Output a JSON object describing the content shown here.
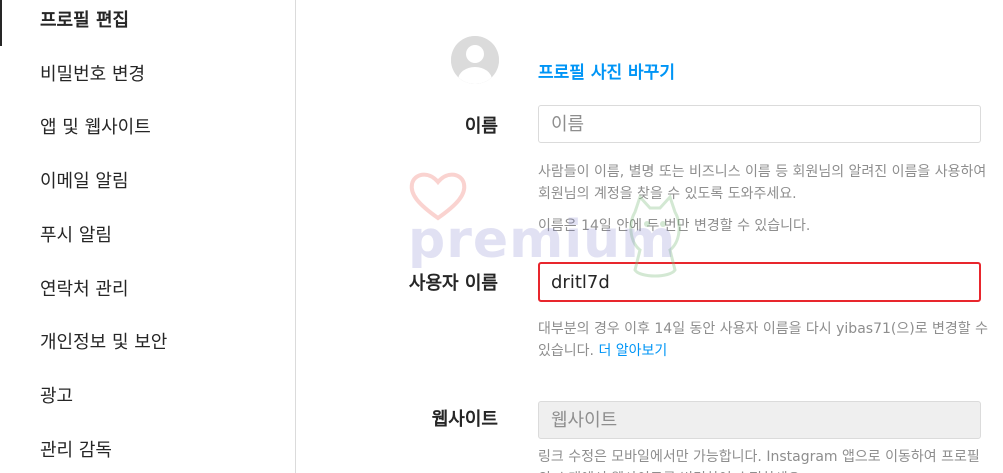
{
  "sidebar": {
    "items": [
      {
        "label": "프로필 편집",
        "active": true
      },
      {
        "label": "비밀번호 변경"
      },
      {
        "label": "앱 및 웹사이트"
      },
      {
        "label": "이메일 알림"
      },
      {
        "label": "푸시 알림"
      },
      {
        "label": "연락처 관리"
      },
      {
        "label": "개인정보 및 보안"
      },
      {
        "label": "광고"
      },
      {
        "label": "관리 감독"
      }
    ]
  },
  "profile": {
    "change_photo_label": "프로필 사진 바꾸기"
  },
  "name_field": {
    "label": "이름",
    "value": "",
    "placeholder": "이름",
    "help_line1": "사람들이 이름, 별명 또는 비즈니스 이름 등 회원님의 알려진 이름을 사용하여 회원님의 계정을 찾을 수 있도록 도와주세요.",
    "help_line2": "이름은 14일 안에 두 번만 변경할 수 있습니다."
  },
  "username_field": {
    "label": "사용자 이름",
    "value": "dritl7d",
    "help_text": "대부분의 경우 이후 14일 동안 사용자 이름을 다시 yibas71(으)로 변경할 수 있습니다.",
    "help_link": "더 알아보기"
  },
  "website_field": {
    "label": "웹사이트",
    "value": "",
    "placeholder": "웹사이트",
    "help_text": "링크 수정은 모바일에서만 가능합니다. Instagram 앱으로 이동하여 프로필의 소개에서 웹사이트를 변경하여 수정하세요."
  },
  "watermark": {
    "text": "premium"
  },
  "colors": {
    "accent": "#0095f6",
    "focus_border": "#e8262d",
    "muted": "#8e8e8e",
    "border": "#dbdbdb"
  },
  "icons": {
    "avatar": "default-avatar-icon"
  }
}
